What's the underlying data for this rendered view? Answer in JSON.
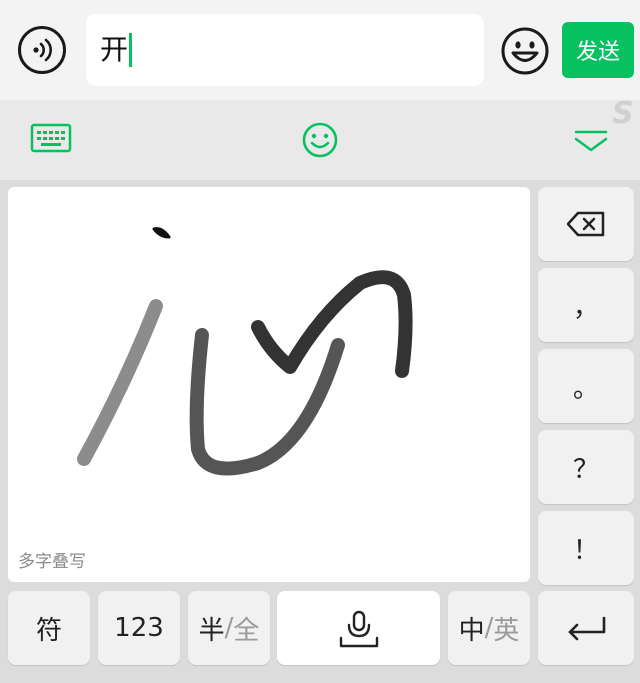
{
  "input": {
    "value": "开"
  },
  "send_label": "发送",
  "handwriting": {
    "hint": "多字叠写"
  },
  "side_keys": {
    "comma": "，",
    "period": "。",
    "question": "？",
    "exclaim": "！"
  },
  "bottom_keys": {
    "symbols": "符",
    "numbers": "123",
    "half": "半",
    "sep1": "/",
    "full": "全",
    "chinese": "中",
    "sep2": "/",
    "english": "英"
  },
  "icons": {
    "voice": "voice-icon",
    "emoji": "emoji-icon",
    "keyboard": "keyboard-icon",
    "sticker": "smiley-icon",
    "collapse": "collapse-keyboard-icon",
    "backspace": "backspace-icon",
    "microphone": "microphone-icon",
    "enter": "enter-icon"
  },
  "colors": {
    "accent": "#07c160",
    "background": "#dcdcdc",
    "key": "#f1f1f1"
  }
}
